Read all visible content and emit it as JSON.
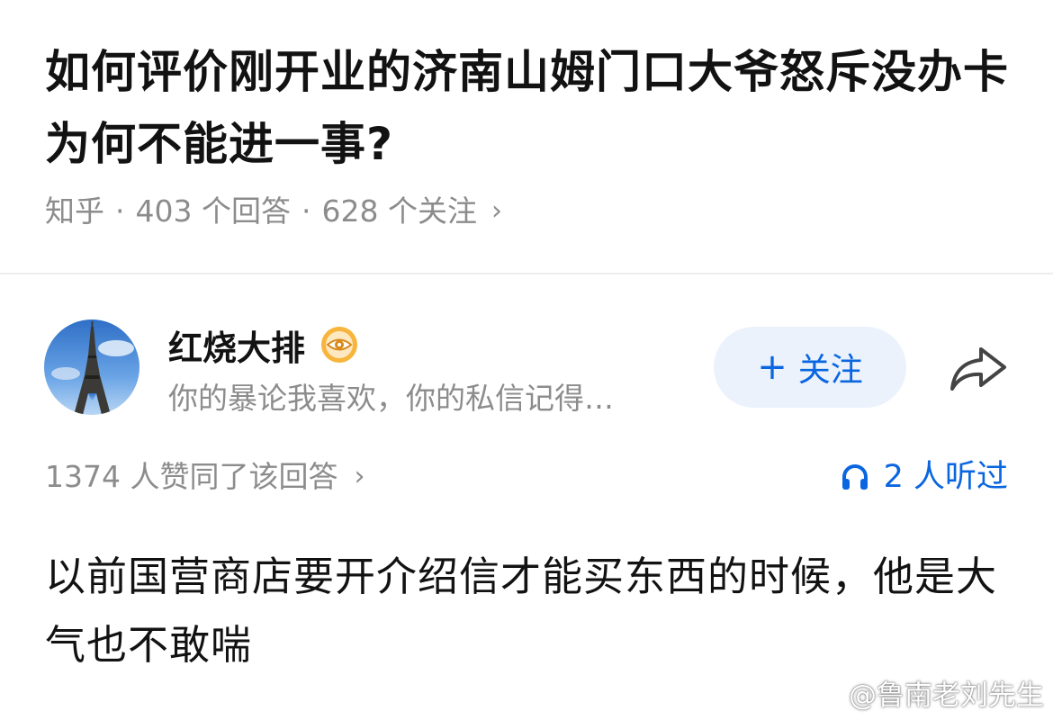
{
  "question": {
    "title": "如何评价刚开业的济南山姆门口大爷怒斥没办卡为何不能进一事?",
    "source": "知乎",
    "answers": "403 个回答",
    "followers": "628 个关注"
  },
  "answer": {
    "author_name": "红烧大排",
    "author_bio": "你的暴论我喜欢，你的私信记得…",
    "follow_label": "关注",
    "votes_text": "1374 人赞同了该回答",
    "listen_text": "2 人听过",
    "content": "以前国营商店要开介绍信才能买东西的时候，他是大气也不敢喘"
  },
  "watermark": {
    "text": "@鲁南老刘先生"
  },
  "icons": {
    "share": "share-icon",
    "headphones": "headphones-icon",
    "badge": "eye-badge-icon",
    "chevron": "chevron-right-icon"
  },
  "colors": {
    "accent": "#0a66e0",
    "follow_bg": "#ebf2fc",
    "muted": "#8c8c8c",
    "text": "#121212"
  }
}
